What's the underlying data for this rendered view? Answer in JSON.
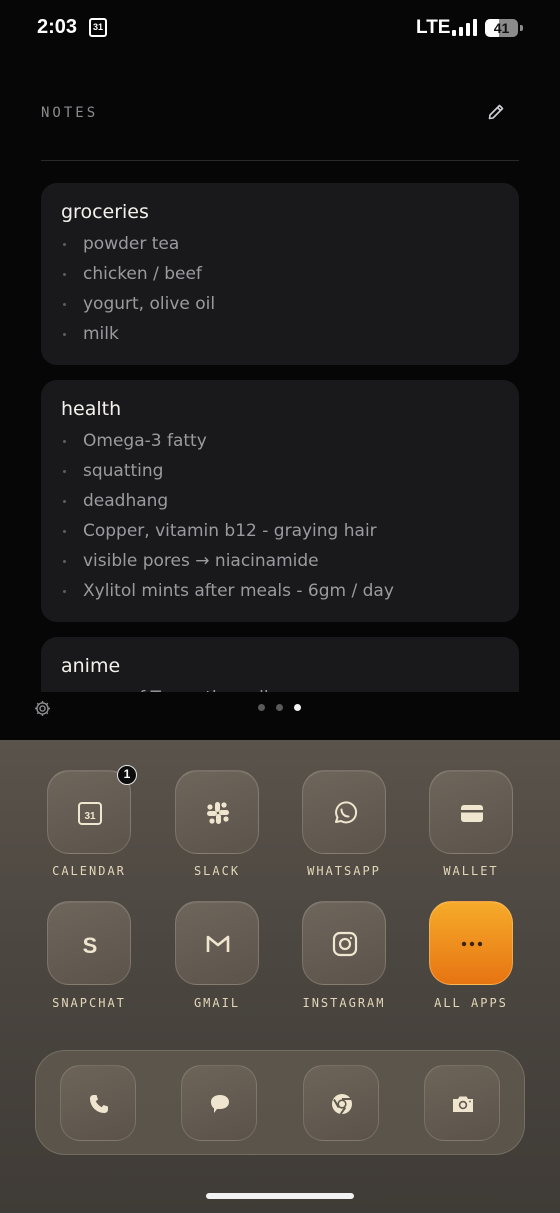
{
  "status_bar": {
    "time": "2:03",
    "calendar_glyph": "31",
    "network": "LTE",
    "battery_level": "41",
    "battery_fraction": 0.41
  },
  "notes": {
    "title": "NOTES",
    "cards": [
      {
        "title": "groceries",
        "items": [
          "powder tea",
          "chicken / beef",
          "yogurt, olive oil",
          "milk"
        ]
      },
      {
        "title": "health",
        "items": [
          "Omega-3 fatty",
          "squatting",
          "deadhang",
          "Copper, vitamin b12 - graying hair",
          "visible pores → niacinamide",
          "Xylitol mints after meals - 6gm / day"
        ]
      },
      {
        "title": "anime",
        "items": [
          "saga of Tanya the evil"
        ]
      }
    ]
  },
  "pager": {
    "count": 3,
    "active_index": 2
  },
  "apps": [
    {
      "label": "CALENDAR",
      "icon": "calendar-icon",
      "glyph": "31",
      "badge": "1"
    },
    {
      "label": "SLACK",
      "icon": "slack-icon"
    },
    {
      "label": "WHATSAPP",
      "icon": "whatsapp-icon"
    },
    {
      "label": "WALLET",
      "icon": "wallet-icon"
    },
    {
      "label": "SNAPCHAT",
      "icon": "snapchat-icon",
      "glyph": "S"
    },
    {
      "label": "GMAIL",
      "icon": "gmail-icon"
    },
    {
      "label": "INSTAGRAM",
      "icon": "instagram-icon"
    },
    {
      "label": "ALL APPS",
      "icon": "more-dots-icon"
    }
  ],
  "dock": [
    {
      "icon": "phone-icon"
    },
    {
      "icon": "messages-icon"
    },
    {
      "icon": "chrome-icon"
    },
    {
      "icon": "camera-icon"
    }
  ],
  "colors": {
    "background": "#060607",
    "card": "#19191b",
    "accent_orange": "#f09020",
    "label_tan": "#e3d6b8"
  }
}
